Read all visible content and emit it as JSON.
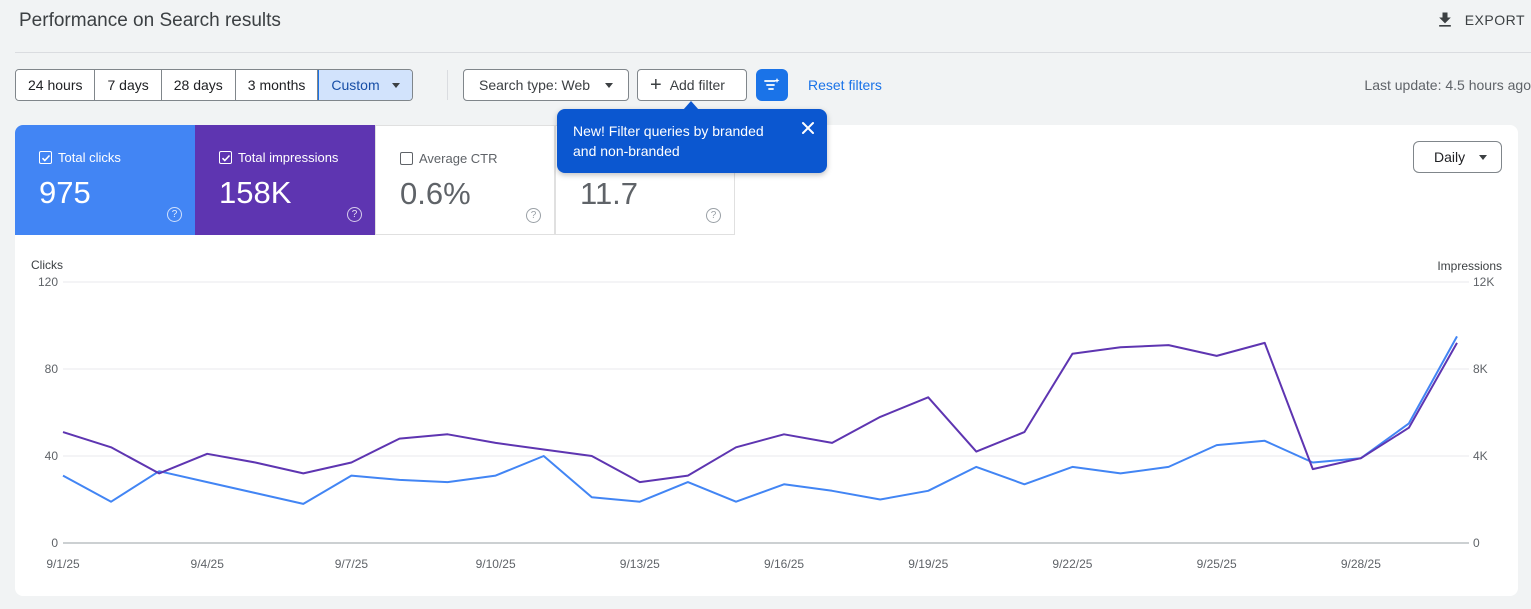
{
  "header": {
    "title": "Performance on Search results",
    "export_label": "EXPORT"
  },
  "filters": {
    "date_ranges": [
      "24 hours",
      "7 days",
      "28 days",
      "3 months",
      "Custom"
    ],
    "active_range": "Custom",
    "search_type": "Search type: Web",
    "add_filter": "Add filter",
    "reset_filters": "Reset filters",
    "last_update": "Last update: 4.5 hours ago"
  },
  "metrics": {
    "clicks": {
      "label": "Total clicks",
      "value": "975",
      "checked": true,
      "color": "#4285f4"
    },
    "impressions": {
      "label": "Total impressions",
      "value": "158K",
      "checked": true,
      "color": "#5e35b1"
    },
    "ctr": {
      "label": "Average CTR",
      "value": "0.6%",
      "checked": false
    },
    "position": {
      "label": "",
      "value": "11.7"
    }
  },
  "tooltip": {
    "text": "New! Filter queries by branded and non-branded"
  },
  "granularity": "Daily",
  "chart_data": {
    "type": "line",
    "xlabel": "",
    "ylabel": "Clicks",
    "y2label": "Impressions",
    "ylim": [
      0,
      120
    ],
    "y2lim": [
      0,
      12000
    ],
    "yticks": [
      "0",
      "40",
      "80",
      "120"
    ],
    "y2ticks": [
      "0",
      "4K",
      "8K",
      "12K"
    ],
    "x": [
      "9/1/25",
      "9/2/25",
      "9/3/25",
      "9/4/25",
      "9/5/25",
      "9/6/25",
      "9/7/25",
      "9/8/25",
      "9/9/25",
      "9/10/25",
      "9/11/25",
      "9/12/25",
      "9/13/25",
      "9/14/25",
      "9/15/25",
      "9/16/25",
      "9/17/25",
      "9/18/25",
      "9/19/25",
      "9/20/25",
      "9/21/25",
      "9/22/25",
      "9/23/25",
      "9/24/25",
      "9/25/25",
      "9/26/25",
      "9/27/25",
      "9/28/25",
      "9/29/25",
      "9/30/25"
    ],
    "x_tick_labels": [
      "9/1/25",
      "9/4/25",
      "9/7/25",
      "9/10/25",
      "9/13/25",
      "9/16/25",
      "9/19/25",
      "9/22/25",
      "9/25/25",
      "9/28/25"
    ],
    "series": [
      {
        "name": "Clicks",
        "axis": "left",
        "color": "#4285f4",
        "values": [
          31,
          19,
          33,
          28,
          23,
          18,
          31,
          29,
          28,
          31,
          40,
          21,
          19,
          28,
          19,
          27,
          24,
          20,
          24,
          35,
          27,
          35,
          32,
          35,
          45,
          47,
          37,
          39,
          55,
          95
        ]
      },
      {
        "name": "Impressions",
        "axis": "right",
        "color": "#5e35b1",
        "values": [
          5100,
          4400,
          3200,
          4100,
          3700,
          3200,
          3700,
          4800,
          5000,
          4600,
          4300,
          4000,
          2800,
          3100,
          4400,
          5000,
          4600,
          5800,
          6700,
          4200,
          5100,
          8700,
          9000,
          9100,
          8600,
          9200,
          3400,
          3900,
          5300,
          9200
        ]
      }
    ]
  }
}
